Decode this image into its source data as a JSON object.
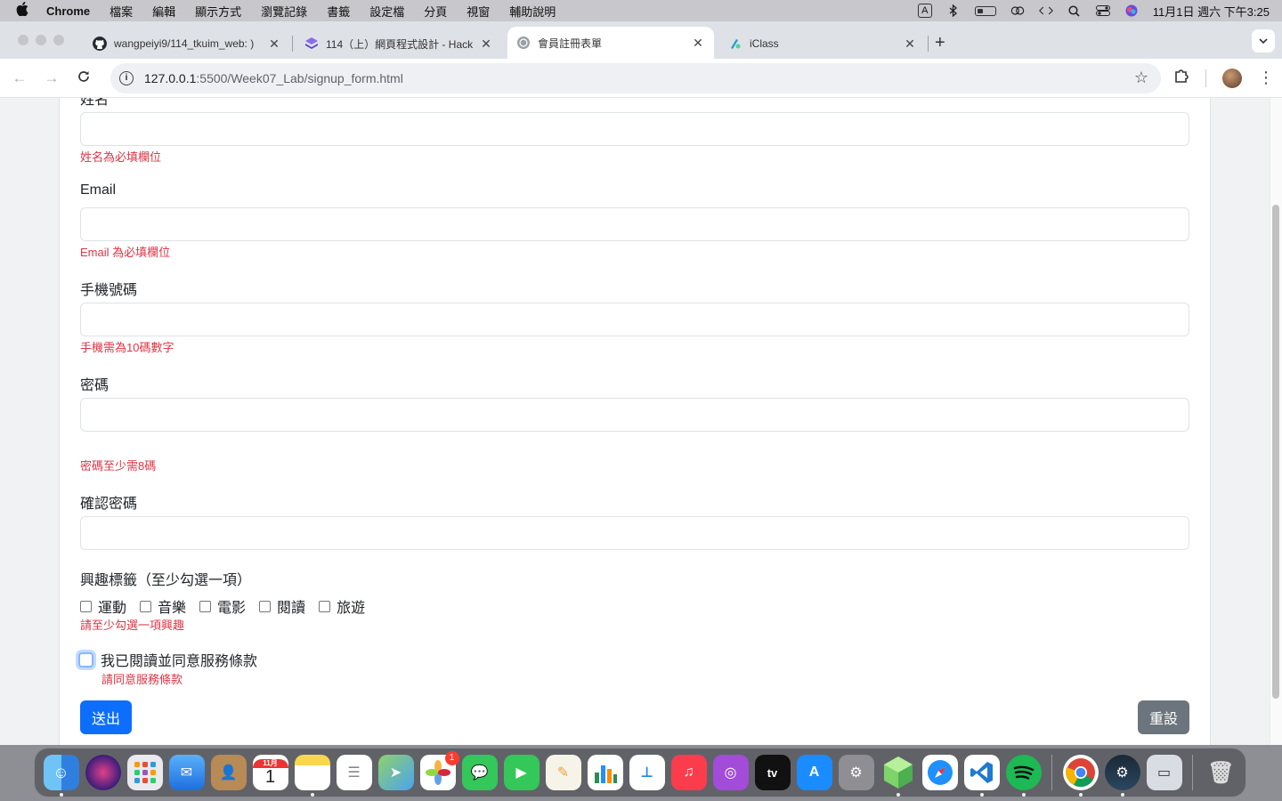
{
  "menubar": {
    "apple": "",
    "app_name": "Chrome",
    "items": [
      "檔案",
      "編輯",
      "顯示方式",
      "瀏覽記錄",
      "書籤",
      "設定檔",
      "分頁",
      "視窗",
      "輔助說明"
    ],
    "input_source": "A",
    "clock": "11月1日 週六 下午3:25"
  },
  "tabs": [
    {
      "title": "wangpeiyi9/114_tkuim_web: )",
      "favicon_color": "#24292f"
    },
    {
      "title": "114（上）網頁程式設計 - Hack",
      "favicon_color": "#7b5cf0"
    },
    {
      "title": "會員註冊表單",
      "favicon_color": "#9aa0a6"
    },
    {
      "title": "iClass",
      "favicon_color": "#1da1c4"
    }
  ],
  "toolbar": {
    "url_host": "127.0.0.1",
    "url_path": ":5500/Week07_Lab/signup_form.html"
  },
  "form": {
    "name_label": "姓名",
    "name_error": "姓名為必填欄位",
    "email_label": "Email",
    "email_error": "Email 為必填欄位",
    "phone_label": "手機號碼",
    "phone_error": "手機需為10碼數字",
    "password_label": "密碼",
    "password_error": "密碼至少需8碼",
    "confirm_label": "確認密碼",
    "interests_label": "興趣標籤（至少勾選一項）",
    "interests": [
      "運動",
      "音樂",
      "電影",
      "閱讀",
      "旅遊"
    ],
    "interests_error": "請至少勾選一項興趣",
    "terms_label": "我已閱讀並同意服務條款",
    "terms_error": "請同意服務條款",
    "submit_label": "送出",
    "reset_label": "重設"
  },
  "colors": {
    "primary": "#0d6efd",
    "secondary": "#6c757d",
    "danger": "#dc3545"
  },
  "dock": {
    "calendar_month": "11月",
    "calendar_day": "1",
    "photos_badge": "1",
    "tv_label": "tv"
  }
}
